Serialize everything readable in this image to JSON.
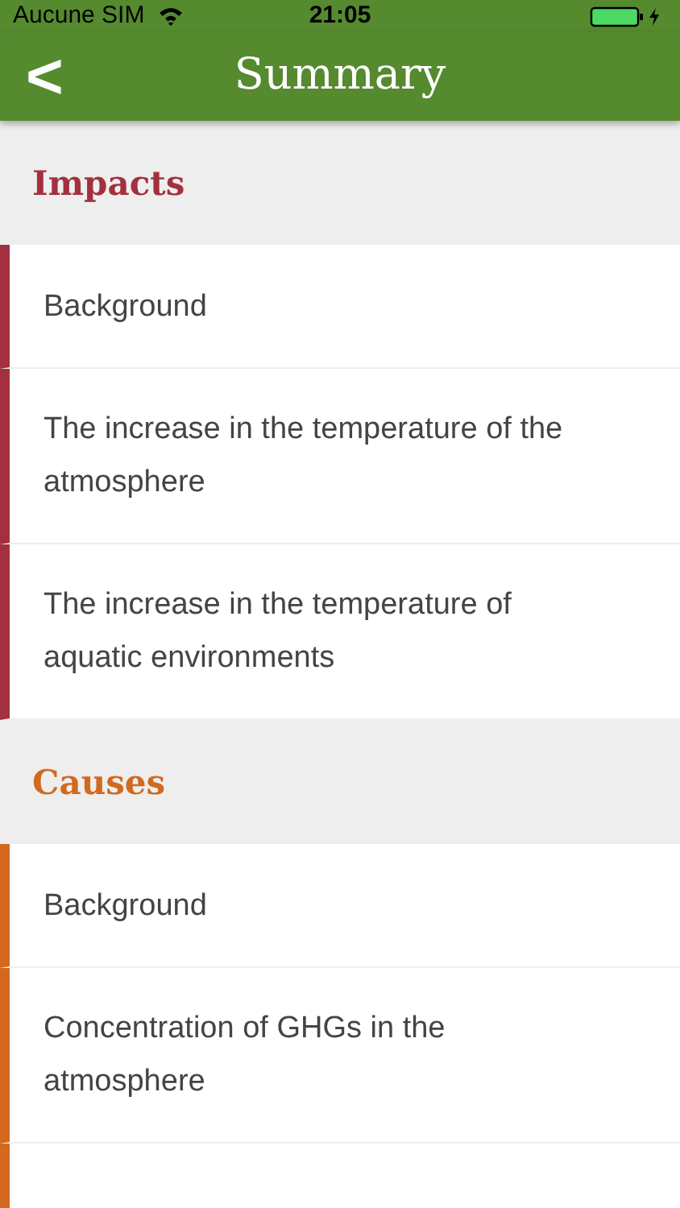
{
  "status_bar": {
    "carrier": "Aucune SIM",
    "time": "21:05"
  },
  "nav": {
    "back": "<",
    "title": "Summary"
  },
  "sections": [
    {
      "title": "Impacts",
      "color": "#a3303e",
      "items": [
        "Background",
        "The increase in the temperature of the atmosphere",
        "The increase in the temperature of aquatic environments"
      ]
    },
    {
      "title": "Causes",
      "color": "#d2691f",
      "items": [
        "Background",
        "Concentration of GHGs in the atmosphere"
      ]
    }
  ]
}
